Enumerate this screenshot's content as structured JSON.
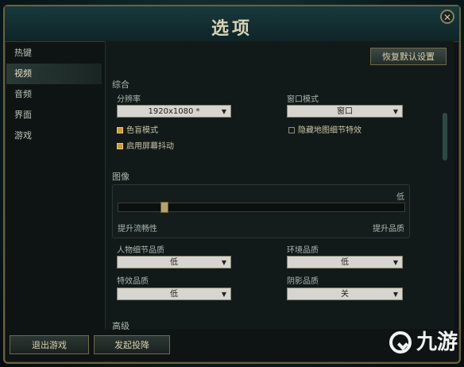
{
  "window": {
    "title": "选项",
    "close_symbol": "✕"
  },
  "sidebar": {
    "items": [
      {
        "label": "热键"
      },
      {
        "label": "视频"
      },
      {
        "label": "音频"
      },
      {
        "label": "界面"
      },
      {
        "label": "游戏"
      }
    ],
    "active_index": 1
  },
  "content": {
    "reset_button": "恢复默认设置",
    "general": {
      "title": "综合",
      "resolution_label": "分辨率",
      "resolution_value": "1920x1080 *",
      "window_mode_label": "窗口模式",
      "window_mode_value": "窗口",
      "colorblind_label": "色盲模式",
      "colorblind_checked": true,
      "screen_shake_label": "启用屏幕抖动",
      "screen_shake_checked": true,
      "hide_eye_candy_label": "隐藏地图细节特效",
      "hide_eye_candy_checked": false
    },
    "graphics": {
      "title": "图像",
      "level_label": "低",
      "slider_level_fraction": 0.15,
      "left_hint": "提升流畅性",
      "right_hint": "提升品质",
      "character_quality_label": "人物细节品质",
      "character_quality_value": "低",
      "environment_quality_label": "环境品质",
      "environment_quality_value": "低",
      "effects_quality_label": "特效品质",
      "effects_quality_value": "低",
      "shadow_quality_label": "阴影品质",
      "shadow_quality_value": "关"
    },
    "next_section_title": "高级"
  },
  "footer": {
    "exit_button": "退出游戏",
    "surrender_button": "发起投降"
  },
  "watermark": {
    "text": "九游"
  },
  "colors": {
    "accent_gold": "#d39a2f",
    "frame_border": "#6b6339"
  }
}
